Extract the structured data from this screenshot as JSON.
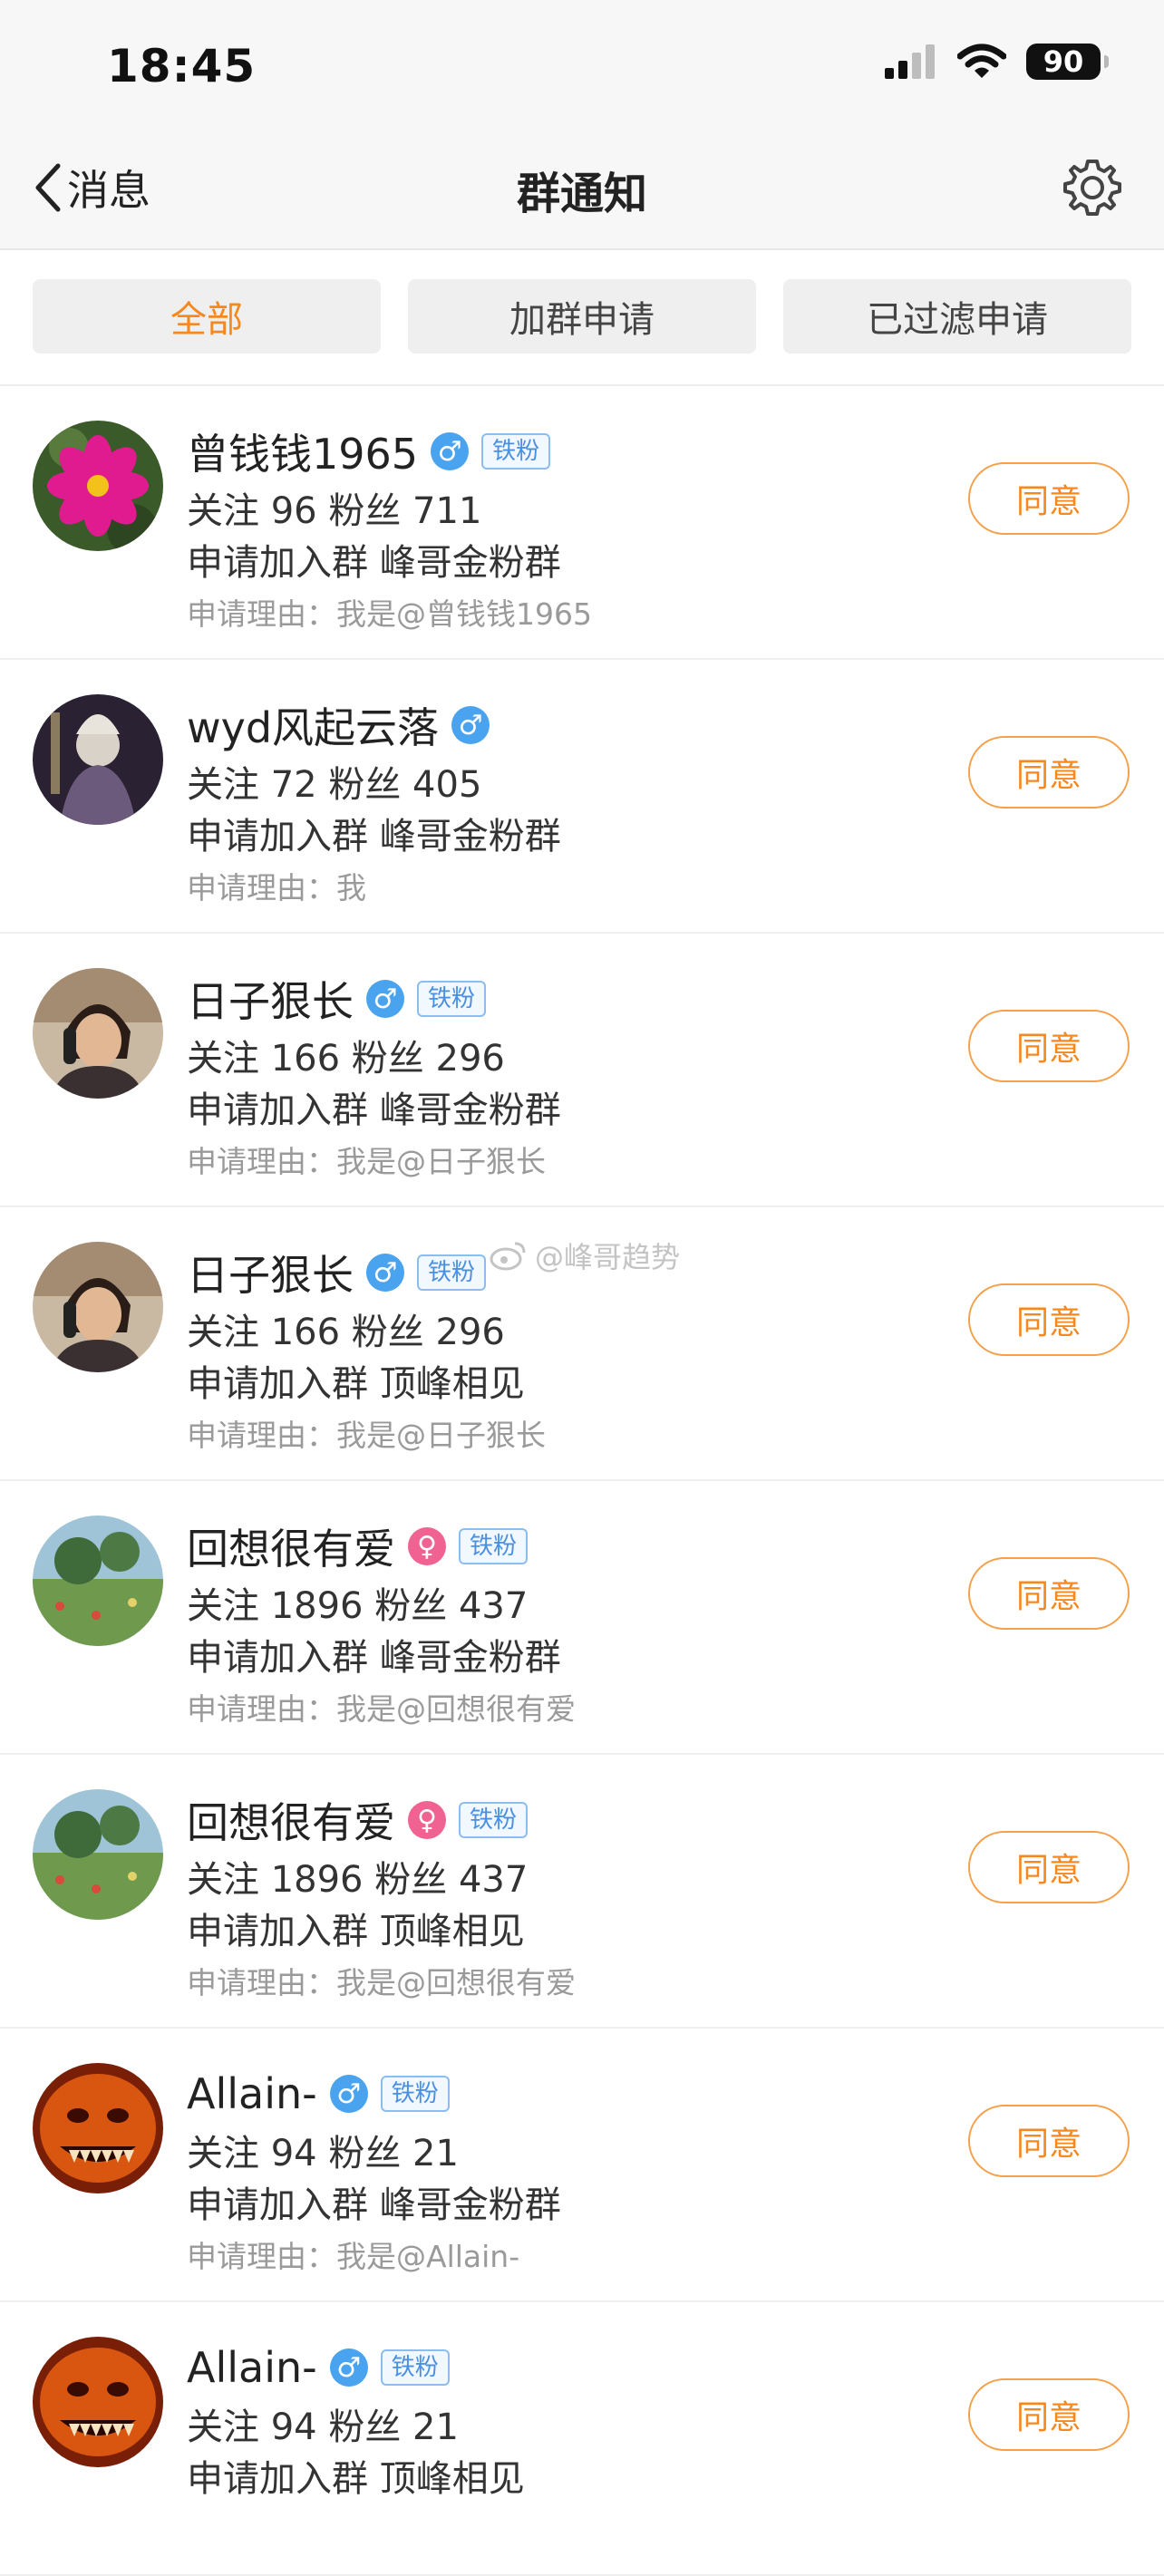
{
  "status": {
    "time": "18:45",
    "battery": "90"
  },
  "nav": {
    "back_label": "消息",
    "title": "群通知"
  },
  "tabs": [
    {
      "label": "全部",
      "active": true
    },
    {
      "label": "加群申请",
      "active": false
    },
    {
      "label": "已过滤申请",
      "active": false
    }
  ],
  "agree_label": "同意",
  "watermark": "@峰哥趋势",
  "colors": {
    "accent": "#f5891f",
    "badge_blue": "#4a90e2",
    "male": "#4aa3ee",
    "female": "#f06292"
  },
  "requests": [
    {
      "name": "曾钱钱1965",
      "gender": "♂",
      "badge": "铁粉",
      "stats": "关注 96  粉丝 711",
      "apply": "申请加入群 峰哥金粉群",
      "reason": "申请理由：我是@曾钱钱1965",
      "avatar": "pink-flower"
    },
    {
      "name": "wyd风起云落",
      "gender": "♂",
      "badge": "",
      "stats": "关注 72  粉丝 405",
      "apply": "申请加入群 峰哥金粉群",
      "reason": "申请理由：我",
      "avatar": "dark-figure"
    },
    {
      "name": "日子狠长",
      "gender": "♂",
      "badge": "铁粉",
      "stats": "关注 166  粉丝 296",
      "apply": "申请加入群 峰哥金粉群",
      "reason": "申请理由：我是@日子狠长",
      "avatar": "man-phone"
    },
    {
      "name": "日子狠长",
      "gender": "♂",
      "badge": "铁粉",
      "stats": "关注 166  粉丝 296",
      "apply": "申请加入群 顶峰相见",
      "reason": "申请理由：我是@日子狠长",
      "avatar": "man-phone"
    },
    {
      "name": "回想很有爱",
      "gender": "♀",
      "badge": "铁粉",
      "stats": "关注 1896  粉丝 437",
      "apply": "申请加入群 峰哥金粉群",
      "reason": "申请理由：我是@回想很有爱",
      "avatar": "painting"
    },
    {
      "name": "回想很有爱",
      "gender": "♀",
      "badge": "铁粉",
      "stats": "关注 1896  粉丝 437",
      "apply": "申请加入群 顶峰相见",
      "reason": "申请理由：我是@回想很有爱",
      "avatar": "painting"
    },
    {
      "name": "Allain-",
      "gender": "♂",
      "badge": "铁粉",
      "stats": "关注 94  粉丝 21",
      "apply": "申请加入群 峰哥金粉群",
      "reason": "申请理由：我是@Allain-",
      "avatar": "orange-face"
    },
    {
      "name": "Allain-",
      "gender": "♂",
      "badge": "铁粉",
      "stats": "关注 94  粉丝 21",
      "apply": "申请加入群 顶峰相见",
      "reason": "",
      "avatar": "orange-face"
    }
  ]
}
